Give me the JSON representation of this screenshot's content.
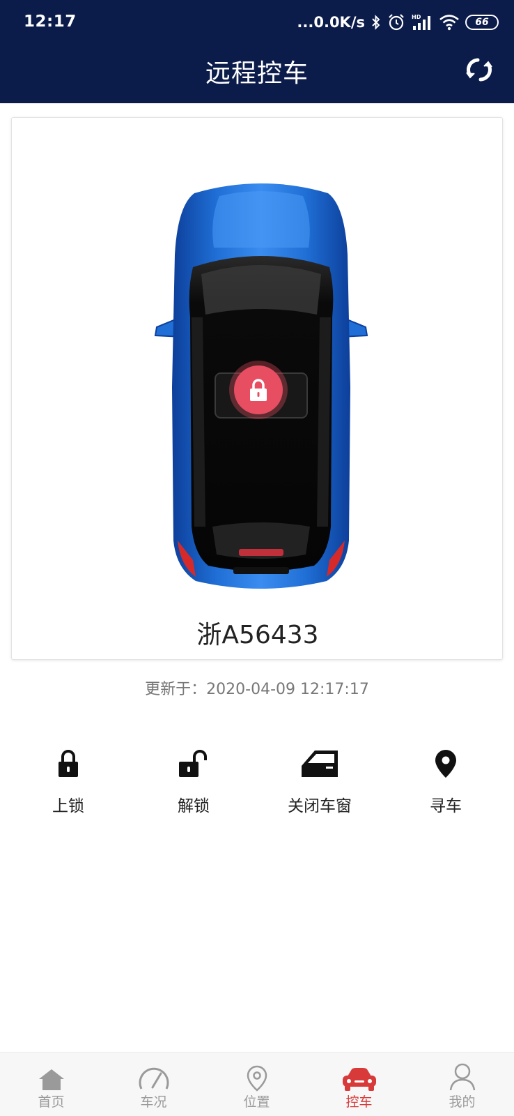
{
  "status_bar": {
    "time": "12:17",
    "network_speed": "...0.0K/s",
    "battery_level": "66",
    "icons": [
      "bluetooth-icon",
      "alarm-icon",
      "hd-signal-icon",
      "wifi-icon",
      "battery-icon"
    ]
  },
  "header": {
    "title": "远程控车",
    "refresh_icon": "refresh-icon"
  },
  "vehicle": {
    "plate": "浙A56433",
    "lock_state_icon": "lock-icon"
  },
  "updated": {
    "text": "更新于：2020-04-09 12:17:17"
  },
  "actions": [
    {
      "label": "上锁",
      "icon": "lock-icon"
    },
    {
      "label": "解锁",
      "icon": "unlock-icon"
    },
    {
      "label": "关闭车窗",
      "icon": "car-door-icon"
    },
    {
      "label": "寻车",
      "icon": "location-pin-icon"
    }
  ],
  "tabs": [
    {
      "label": "首页",
      "icon": "home-icon",
      "active": false
    },
    {
      "label": "车况",
      "icon": "speedometer-icon",
      "active": false
    },
    {
      "label": "位置",
      "icon": "map-pin-icon",
      "active": false
    },
    {
      "label": "控车",
      "icon": "car-icon",
      "active": true
    },
    {
      "label": "我的",
      "icon": "user-icon",
      "active": false
    }
  ],
  "colors": {
    "header_bg": "#0b1b4a",
    "accent": "#d83a3a",
    "lock_badge": "#e84e62",
    "car_body": "#1f6fd6"
  }
}
